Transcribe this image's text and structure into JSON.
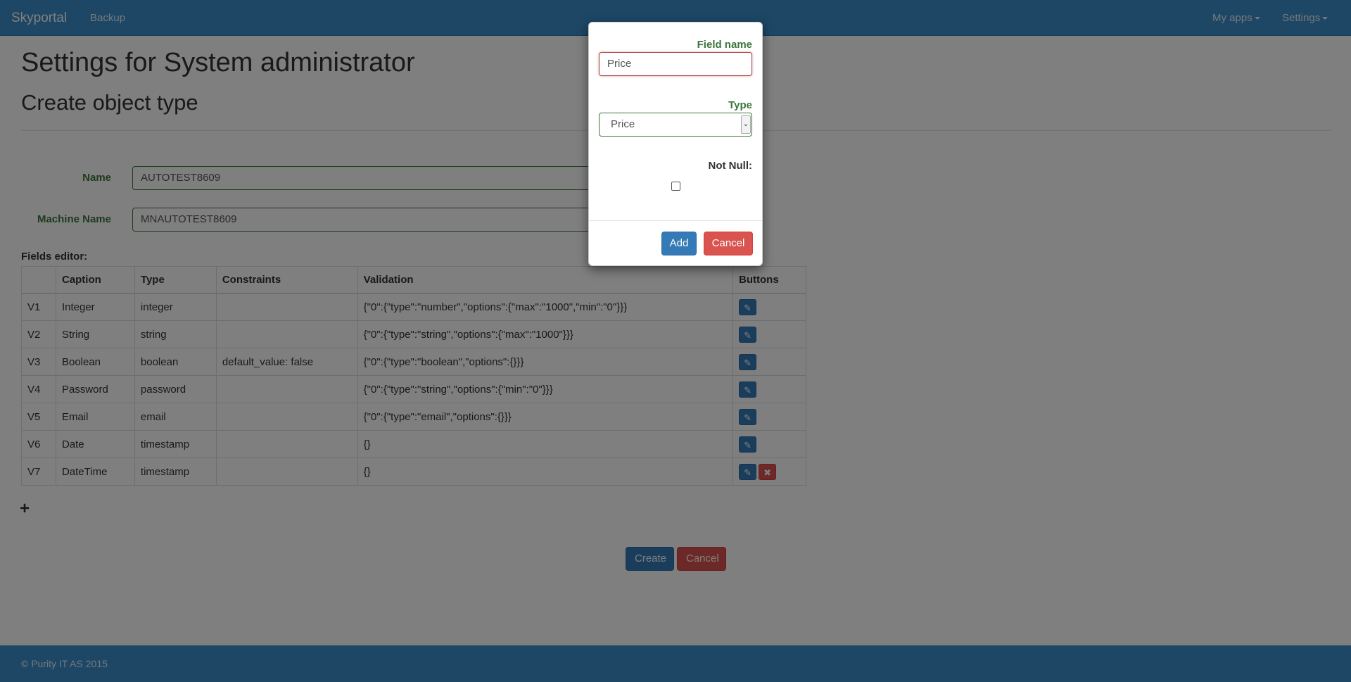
{
  "navbar": {
    "brand": "Skyportal",
    "backup": "Backup",
    "my_apps": "My apps",
    "settings": "Settings"
  },
  "page": {
    "title": "Settings for System administrator",
    "subtitle": "Create object type"
  },
  "form": {
    "name_label": "Name",
    "name_value": "AUTOTEST8609",
    "machine_name_label": "Machine Name",
    "machine_name_value": "MNAUTOTEST8609",
    "fields_editor_label": "Fields editor:"
  },
  "table": {
    "headers": [
      "",
      "Caption",
      "Type",
      "Constraints",
      "Validation",
      "Buttons"
    ],
    "rows": [
      {
        "id": "V1",
        "caption": "Integer",
        "type": "integer",
        "constraints": "",
        "validation": "{\"0\":{\"type\":\"number\",\"options\":{\"max\":\"1000\",\"min\":\"0\"}}}",
        "deletable": false
      },
      {
        "id": "V2",
        "caption": "String",
        "type": "string",
        "constraints": "",
        "validation": "{\"0\":{\"type\":\"string\",\"options\":{\"max\":\"1000\"}}}",
        "deletable": false
      },
      {
        "id": "V3",
        "caption": "Boolean",
        "type": "boolean",
        "constraints": "default_value: false",
        "validation": "{\"0\":{\"type\":\"boolean\",\"options\":{}}}",
        "deletable": false
      },
      {
        "id": "V4",
        "caption": "Password",
        "type": "password",
        "constraints": "",
        "validation": "{\"0\":{\"type\":\"string\",\"options\":{\"min\":\"0\"}}}",
        "deletable": false
      },
      {
        "id": "V5",
        "caption": "Email",
        "type": "email",
        "constraints": "",
        "validation": "{\"0\":{\"type\":\"email\",\"options\":{}}}",
        "deletable": false
      },
      {
        "id": "V6",
        "caption": "Date",
        "type": "timestamp",
        "constraints": "",
        "validation": "{}",
        "deletable": false
      },
      {
        "id": "V7",
        "caption": "DateTime",
        "type": "timestamp",
        "constraints": "",
        "validation": "{}",
        "deletable": true
      }
    ]
  },
  "add_field_symbol": "+",
  "buttons": {
    "create": "Create",
    "cancel": "Cancel"
  },
  "footer": {
    "text": "© Purity IT AS 2015"
  },
  "modal": {
    "field_name_label": "Field name",
    "field_name_value": "Price",
    "type_label": "Type",
    "type_selected": "Price",
    "not_null_label": "Not Null:",
    "not_null_checked": false,
    "add_button": "Add",
    "cancel_button": "Cancel"
  },
  "icons": {
    "edit": "pencil-icon",
    "delete": "remove-icon",
    "add": "plus-icon"
  },
  "colors": {
    "navbar": "#3a8fc8",
    "primary": "#337ab7",
    "danger": "#d9534f",
    "success_label": "#3c763d",
    "error_border": "#a94442"
  }
}
